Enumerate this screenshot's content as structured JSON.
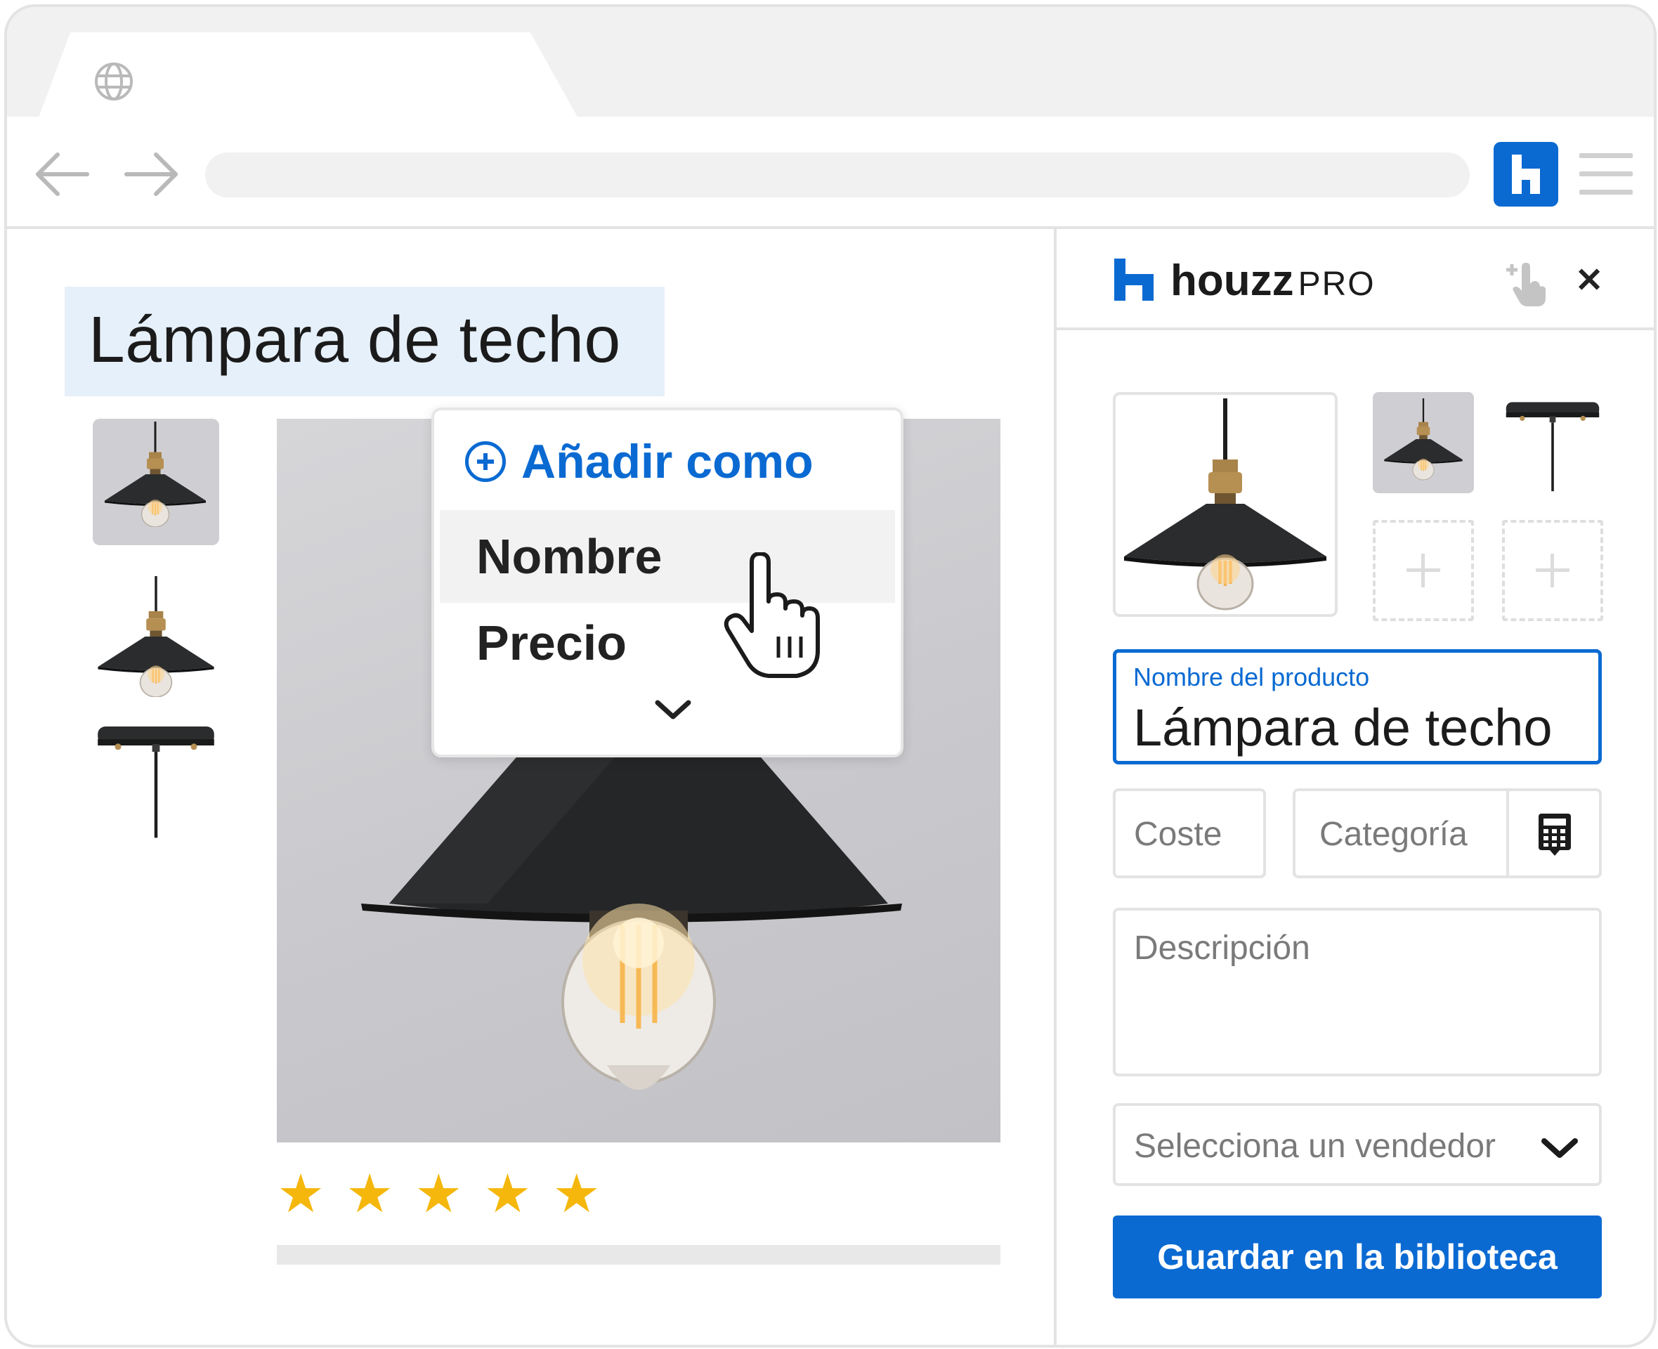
{
  "page": {
    "title": "Lámpara de techo",
    "rating_stars": 5
  },
  "dropdown": {
    "header": "Añadir como",
    "items": [
      "Nombre",
      "Precio"
    ],
    "selected": "Nombre"
  },
  "panel": {
    "brand": "houzz",
    "brand_suffix": "PRO",
    "product_name_label": "Nombre del producto",
    "product_name_value": "Lámpara de techo",
    "cost_placeholder": "Coste",
    "category_placeholder": "Categoría",
    "description_placeholder": "Descripción",
    "vendor_placeholder": "Selecciona un vendedor",
    "save_label": "Guardar en la biblioteca"
  },
  "colors": {
    "accent": "#0a6ad2",
    "star": "#f5b70c",
    "title_highlight": "#e6f0fa"
  },
  "icons": [
    "globe-icon",
    "back-arrow-icon",
    "forward-arrow-icon",
    "houzz-extension-icon",
    "menu-icon",
    "tap-icon",
    "close-icon",
    "calculator-icon",
    "chevron-down-icon",
    "hand-cursor-icon",
    "add-circle-icon"
  ]
}
